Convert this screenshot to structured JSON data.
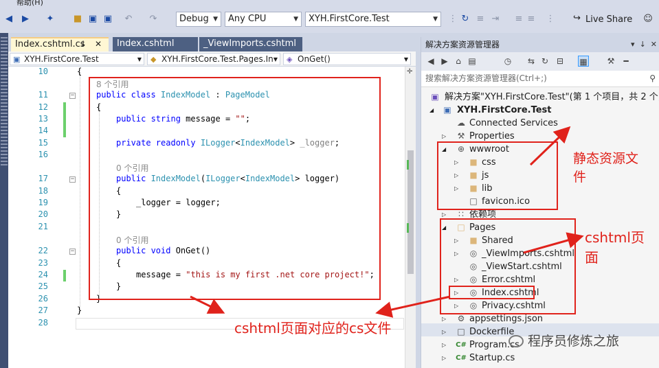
{
  "menu": {
    "help": "帮助(H)"
  },
  "toolbar": {
    "config": "Debug",
    "platform": "Any CPU",
    "startup_project": "XYH.FirstCore.Test",
    "live_share": "Live Share"
  },
  "doc_tabs": [
    {
      "label": "Index.cshtml.cs",
      "active": true
    },
    {
      "label": "Index.cshtml",
      "active": false
    },
    {
      "label": "_ViewImports.cshtml",
      "active": false
    }
  ],
  "nav": {
    "project": "XYH.FirstCore.Test",
    "class": "XYH.FirstCore.Test.Pages.In",
    "member": "OnGet()"
  },
  "editor": {
    "lines": [
      {
        "n": "10",
        "text": "{"
      },
      {
        "n": "",
        "ref": "8 个引用"
      },
      {
        "n": "11",
        "text": "public class IndexModel : PageModel"
      },
      {
        "n": "12",
        "text": "{"
      },
      {
        "n": "13",
        "text": "public string message = \"\";"
      },
      {
        "n": "14",
        "text": ""
      },
      {
        "n": "15",
        "text": "private readonly ILogger<IndexModel> _logger;"
      },
      {
        "n": "16",
        "text": ""
      },
      {
        "n": "",
        "ref": "0 个引用"
      },
      {
        "n": "17",
        "text": "public IndexModel(ILogger<IndexModel> logger)"
      },
      {
        "n": "18",
        "text": "{"
      },
      {
        "n": "19",
        "text": "_logger = logger;"
      },
      {
        "n": "20",
        "text": "}"
      },
      {
        "n": "21",
        "text": ""
      },
      {
        "n": "",
        "ref": "0 个引用"
      },
      {
        "n": "22",
        "text": "public void OnGet()"
      },
      {
        "n": "23",
        "text": "{"
      },
      {
        "n": "24",
        "text": "message = \"this is my first .net core project!\";"
      },
      {
        "n": "25",
        "text": "}"
      },
      {
        "n": "26",
        "text": "}"
      },
      {
        "n": "27",
        "text": "}"
      },
      {
        "n": "28",
        "text": ""
      }
    ]
  },
  "solution_explorer": {
    "title": "解决方案资源管理器",
    "search_placeholder": "搜索解决方案资源管理器(Ctrl+;)",
    "items": [
      {
        "label": "解决方案\"XYH.FirstCore.Test\"(第 1 个项目，共 2 个)",
        "icon": "solution-icon"
      },
      {
        "label": "XYH.FirstCore.Test",
        "icon": "project-icon"
      },
      {
        "label": "Connected Services",
        "icon": "connected-services-icon"
      },
      {
        "label": "Properties",
        "icon": "wrench-icon"
      },
      {
        "label": "wwwroot",
        "icon": "globe-icon"
      },
      {
        "label": "css",
        "icon": "folder-icon"
      },
      {
        "label": "js",
        "icon": "folder-icon"
      },
      {
        "label": "lib",
        "icon": "folder-icon"
      },
      {
        "label": "favicon.ico",
        "icon": "file-icon"
      },
      {
        "label": "依赖项",
        "icon": "dependencies-icon"
      },
      {
        "label": "Pages",
        "icon": "folder-open-icon"
      },
      {
        "label": "Shared",
        "icon": "folder-icon"
      },
      {
        "label": "_ViewImports.cshtml",
        "icon": "razor-file-icon"
      },
      {
        "label": "_ViewStart.cshtml",
        "icon": "razor-file-icon"
      },
      {
        "label": "Error.cshtml",
        "icon": "razor-file-icon"
      },
      {
        "label": "Index.cshtml",
        "icon": "razor-file-icon"
      },
      {
        "label": "Privacy.cshtml",
        "icon": "razor-file-icon"
      },
      {
        "label": "appsettings.json",
        "icon": "json-file-icon"
      },
      {
        "label": "Dockerfile",
        "icon": "file-icon"
      },
      {
        "label": "Program.cs",
        "icon": "csharp-file-icon"
      },
      {
        "label": "Startup.cs",
        "icon": "csharp-file-icon"
      }
    ]
  },
  "annotations": {
    "static_files": "静态资源文件",
    "cshtml_pages": "cshtml页面",
    "cs_for_cshtml": "cshtml页面对应的cs文件"
  },
  "watermark": "程序员修炼之旅",
  "colors": {
    "annotation": "#e0221b",
    "accent": "#3399ff"
  }
}
